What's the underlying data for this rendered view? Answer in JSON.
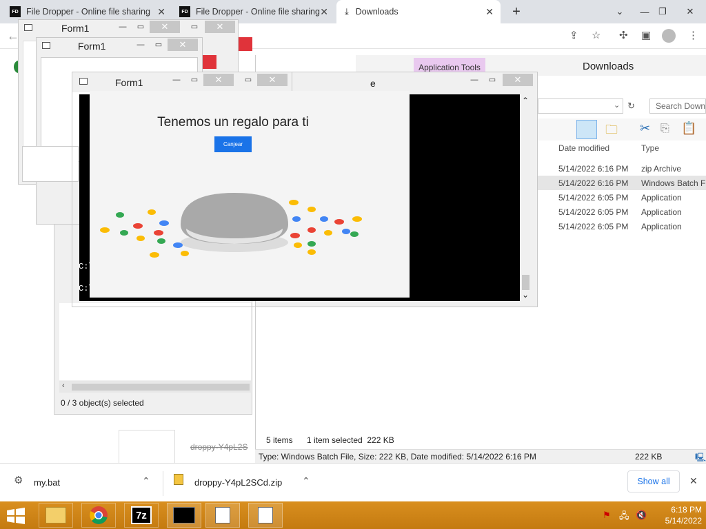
{
  "browser": {
    "tabs": [
      {
        "favicon": "FD",
        "label": "File Dropper - Online file sharing"
      },
      {
        "favicon": "FD",
        "label": "File Dropper - Online file sharing"
      },
      {
        "favicon": "download-icon",
        "label": "Downloads"
      }
    ],
    "new_tab": "+",
    "window_controls": [
      "⌄",
      "—",
      "❐",
      "✕"
    ]
  },
  "forms": [
    {
      "title": "Form1"
    },
    {
      "title": "Form1"
    },
    {
      "title": "Form1"
    }
  ],
  "popup": {
    "headline": "Tenemos un regalo para ti",
    "button_label": "Canjear",
    "button_color": "#1a73e8"
  },
  "explorer": {
    "ribbon_context_tab": "Application Tools",
    "title": "Downloads",
    "search_placeholder": "Search Downl",
    "columns": [
      "Date modified",
      "Type"
    ],
    "rows": [
      {
        "date": "5/14/2022 6:16 PM",
        "type": "zip Archive"
      },
      {
        "date": "5/14/2022 6:16 PM",
        "type": "Windows Batch Fi"
      },
      {
        "date": "5/14/2022 6:05 PM",
        "type": "Application"
      },
      {
        "date": "5/14/2022 6:05 PM",
        "type": "Application"
      },
      {
        "date": "5/14/2022 6:05 PM",
        "type": "Application"
      }
    ],
    "status_items": "5 items",
    "status_selected": "1 item selected  222 KB",
    "details": "Type: Windows Batch File, Size: 222 KB, Date modified: 5/14/2022 6:16 PM",
    "details_size": "222 KB"
  },
  "explorer_left": {
    "status": "0 / 3 object(s) selected"
  },
  "console": {
    "title_fragment": "e",
    "line1": "C:\\",
    "line2": "C:\\Us"
  },
  "background_page": {
    "link_text": "droppy-Y4pL2S"
  },
  "downloads_bar": {
    "items": [
      {
        "name": "my.bat"
      },
      {
        "name": "droppy-Y4pL2SCd.zip"
      }
    ],
    "show_all": "Show all"
  },
  "taskbar": {
    "time": "6:18 PM",
    "date": "5/14/2022",
    "seven_zip_label": "7z"
  }
}
